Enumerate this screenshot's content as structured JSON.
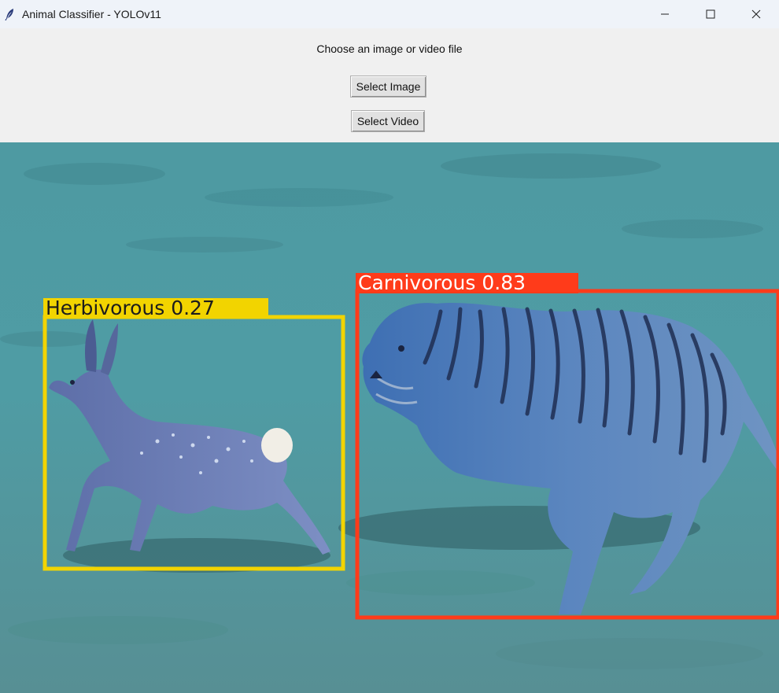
{
  "window": {
    "title": "Animal Classifier - YOLOv11",
    "app_icon": "feather-icon",
    "controls": [
      "minimize-icon",
      "maximize-icon",
      "close-icon"
    ]
  },
  "panel": {
    "prompt": "Choose an image or video file",
    "select_image_label": "Select Image",
    "select_video_label": "Select Video"
  },
  "detections": [
    {
      "label": "Herbivorous 0.27",
      "class": "Herbivorous",
      "confidence": 0.27,
      "color": "#f2d400"
    },
    {
      "label": "Carnivorous 0.83",
      "class": "Carnivorous",
      "confidence": 0.83,
      "color": "#ff3b1a"
    }
  ],
  "colors": {
    "titlebar": "#eff3f9",
    "panel": "#f0f0f0",
    "herbivorous_box": "#f2d400",
    "carnivorous_box": "#ff3b1a"
  }
}
